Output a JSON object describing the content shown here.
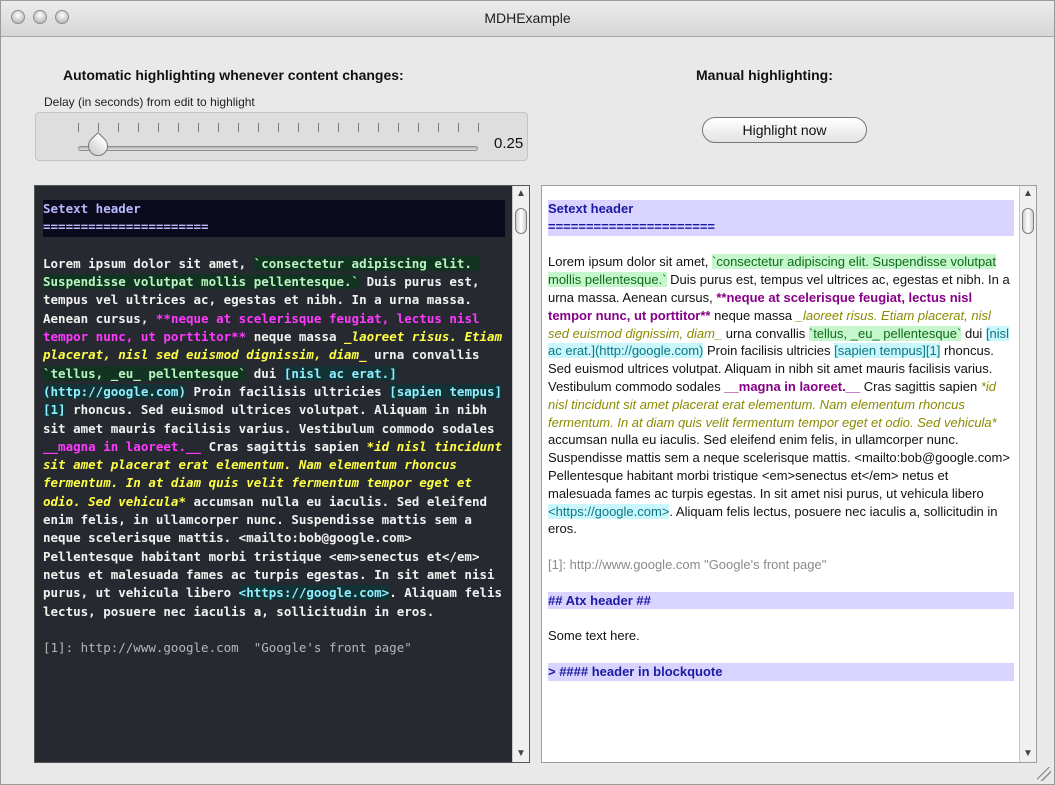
{
  "window": {
    "title": "MDHExample"
  },
  "auto": {
    "heading": "Automatic highlighting whenever content changes:",
    "delay_label": "Delay (in seconds) from edit to highlight",
    "slider_value": "0.25",
    "slider_fraction": 0.05
  },
  "manual": {
    "heading": "Manual highlighting:",
    "button_label": "Highlight now"
  },
  "editor": {
    "header": "Setext header",
    "header_rule": "======================",
    "p1": "Lorem ipsum dolor sit amet, ",
    "c1": "`consectetur adipiscing elit. Suspendisse volutpat mollis pellentesque.`",
    "p2": " Duis purus est, tempus vel ultrices ac, egestas et nibh. In a urna massa. Aenean cursus, ",
    "s1": "**neque at scelerisque feugiat, lectus nisl tempor nunc, ut porttitor**",
    "p3": " neque massa ",
    "e1": "_laoreet risus. Etiam placerat, nisl sed euismod dignissim, diam_",
    "p4": " urna convallis ",
    "c2": "`tellus, _eu_ pellentesque`",
    "p5": " dui ",
    "l1": "[nisl ac erat.](http://google.com)",
    "p6": " Proin facilisis ultricies ",
    "l2": "[sapien tempus][1]",
    "p7": " rhoncus. Sed euismod ultrices volutpat. Aliquam in nibh sit amet mauris facilisis varius. Vestibulum commodo sodales ",
    "s2": "__magna in laoreet.__",
    "p8": " Cras sagittis sapien ",
    "e2": "*id nisl tincidunt sit amet placerat erat elementum. Nam elementum rhoncus fermentum. In at diam quis velit fermentum tempor eget et odio. Sed vehicula*",
    "p9": " accumsan nulla eu iaculis. Sed eleifend enim felis, in ullamcorper nunc. Suspendisse mattis sem a neque scelerisque mattis. <mailto:bob@google.com> Pellentesque habitant morbi tristique <em>senectus et</em> netus et malesuada fames ac turpis egestas. In sit amet nisi purus, ut vehicula libero ",
    "l3": "<https://google.com>",
    "p10": ". Aliquam felis lectus, posuere nec iaculis a, sollicitudin in eros.",
    "ref": "[1]: http://www.google.com  \"Google's front page\""
  },
  "preview": {
    "header": "Setext header",
    "header_rule": "======================",
    "p1": "Lorem ipsum dolor sit amet, ",
    "c1": "`consectetur adipiscing elit. Suspendisse volutpat mollis pellentesque.`",
    "p2": " Duis purus est, tempus vel ultrices ac, egestas et nibh. In a urna massa. Aenean cursus, ",
    "s1": "**neque at scelerisque feugiat, lectus nisl tempor nunc, ut porttitor**",
    "p3": " neque massa ",
    "e1": "_laoreet risus. Etiam placerat, nisl sed euismod dignissim, diam_",
    "p4": " urna convallis ",
    "c2": "`tellus, _eu_ pellentesque`",
    "p5": " dui ",
    "l1": "[nisl ac erat.](http://google.com)",
    "p6": " Proin facilisis ultricies ",
    "l2": "[sapien tempus][1]",
    "p7": " rhoncus. Sed euismod ultrices volutpat. Aliquam in nibh sit amet mauris facilisis varius. Vestibulum commodo sodales ",
    "s2": "__magna in laoreet.__",
    "p8": " Cras sagittis sapien ",
    "e2": "*id nisl tincidunt sit amet placerat erat elementum. Nam elementum rhoncus fermentum. In at diam quis velit fermentum tempor eget et odio. Sed vehicula*",
    "p9": " accumsan nulla eu iaculis. Sed eleifend enim felis, in ullamcorper nunc. Suspendisse mattis sem a neque scelerisque mattis. <mailto:bob@google.com> Pellentesque habitant morbi tristique <em>senectus et</em> netus et malesuada fames ac turpis egestas. In sit amet nisi purus, ut vehicula libero ",
    "l3": "<https://google.com>",
    "p10": ". Aliquam felis lectus, posuere nec iaculis a, sollicitudin in eros.",
    "ref": "[1]: http://www.google.com  \"Google's front page\"",
    "atx": "## Atx header ##",
    "some_text": "Some text here.",
    "bq": "> #### header in blockquote"
  }
}
